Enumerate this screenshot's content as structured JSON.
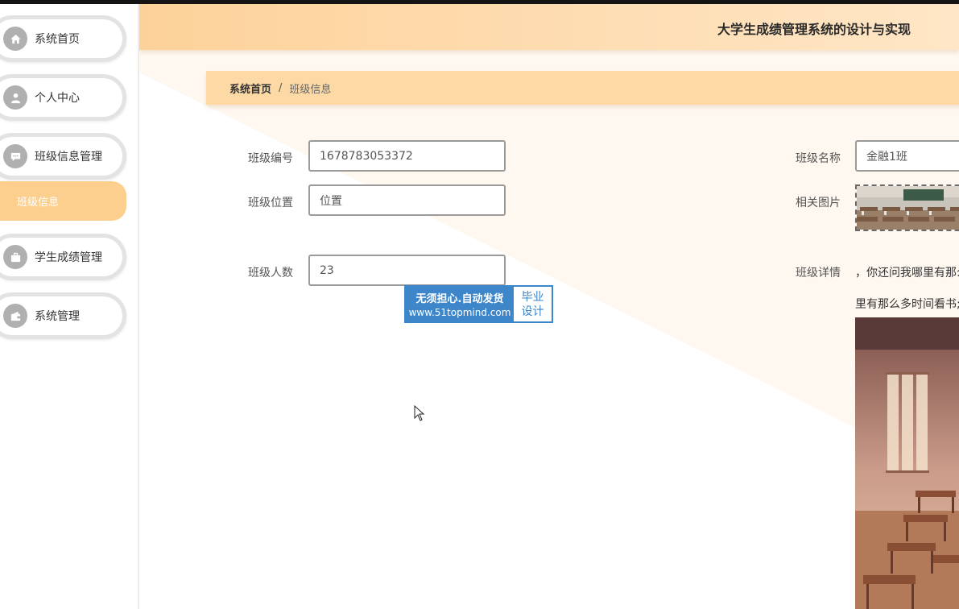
{
  "header": {
    "title": "大学生成绩管理系统的设计与实现"
  },
  "sidebar": {
    "items": [
      {
        "label": "系统首页",
        "icon": "home-icon"
      },
      {
        "label": "个人中心",
        "icon": "user-icon"
      },
      {
        "label": "班级信息管理",
        "icon": "chat-icon"
      },
      {
        "label": "学生成绩管理",
        "icon": "briefcase-icon"
      },
      {
        "label": "系统管理",
        "icon": "wallet-icon"
      }
    ],
    "sub_item": "班级信息",
    "active_color": "#fdcf8f"
  },
  "breadcrumb": {
    "home": "系统首页",
    "separator": "/",
    "current": "班级信息"
  },
  "form": {
    "class_id": {
      "label": "班级编号",
      "value": "1678783053372"
    },
    "class_name": {
      "label": "班级名称",
      "value": "金融1班"
    },
    "class_location": {
      "label": "班级位置",
      "value": "位置"
    },
    "related_image": {
      "label": "相关图片"
    },
    "class_size": {
      "label": "班级人数",
      "value": "23"
    },
    "class_detail": {
      "label": "班级详情",
      "line1": "，你还问我哪里有那么",
      "line2": "里有那么多时间看书;"
    }
  },
  "watermark": {
    "line1": "无须担心.自动发货",
    "line2": "www.51topmind.com",
    "badge1": "毕业",
    "badge2": "设计",
    "color": "#3d86c9"
  },
  "theme": {
    "accent": "#fdcf8f",
    "header_start": "#fdd29a",
    "header_end": "#ffe6c6"
  }
}
